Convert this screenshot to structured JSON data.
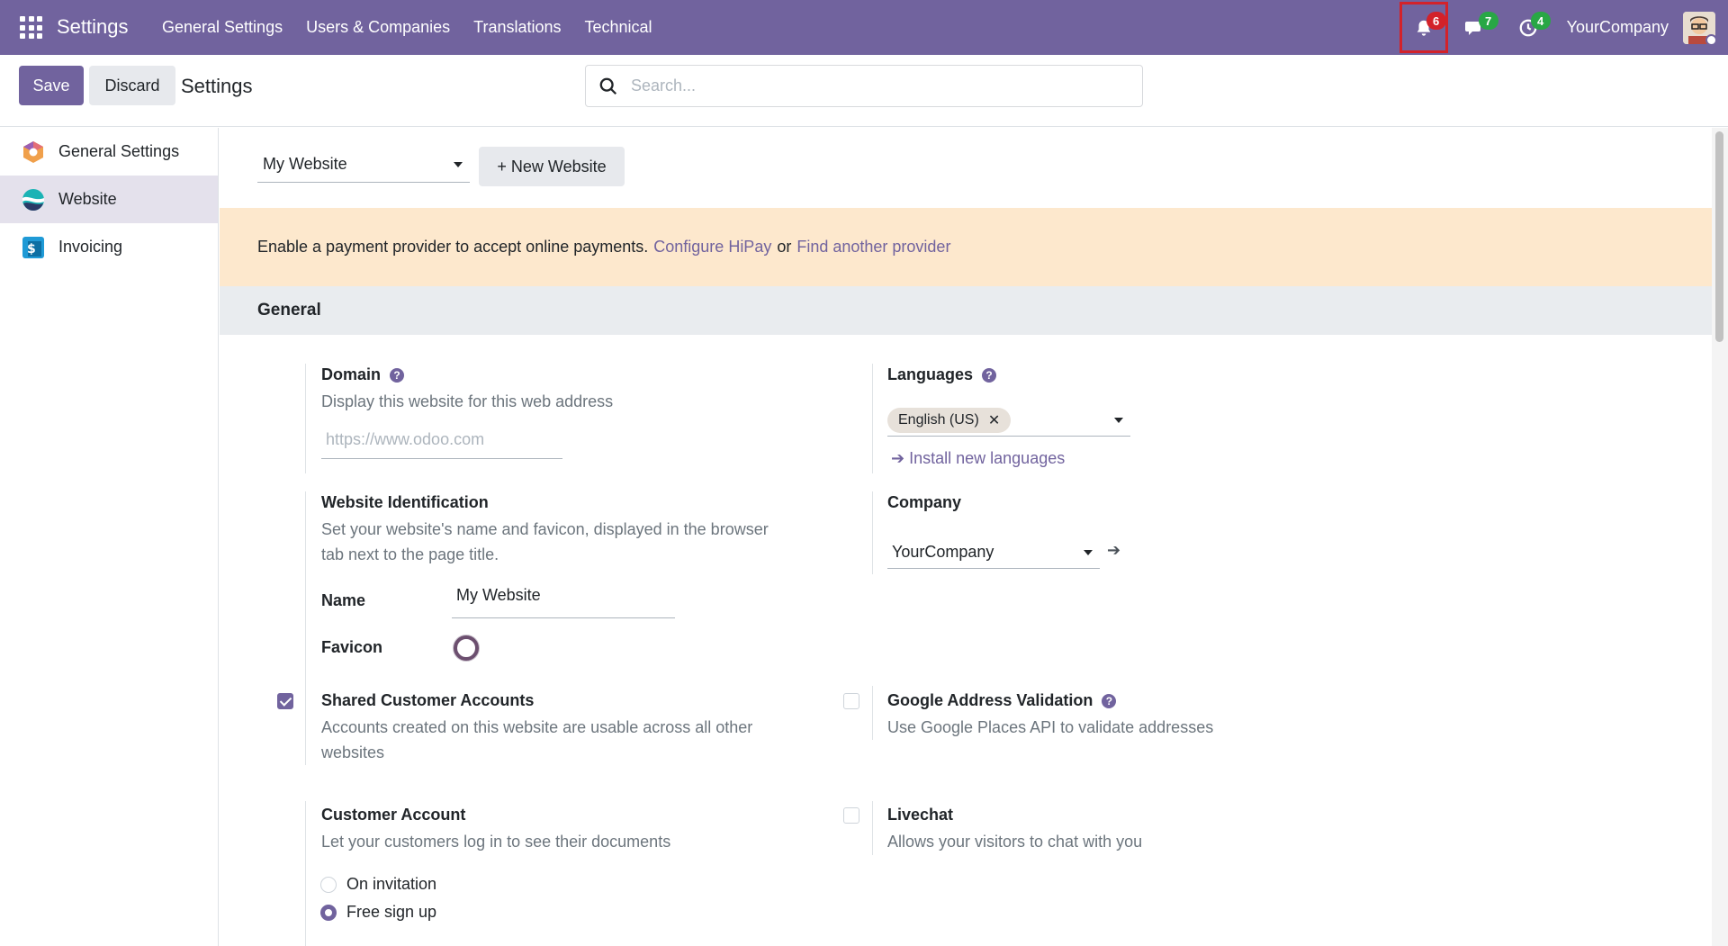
{
  "navbar": {
    "brand": "Settings",
    "menu": [
      "General Settings",
      "Users & Companies",
      "Translations",
      "Technical"
    ],
    "activity_count": "6",
    "messages_count": "7",
    "clock_count": "4",
    "company": "YourCompany"
  },
  "control": {
    "save_label": "Save",
    "discard_label": "Discard",
    "title": "Settings",
    "search_placeholder": "Search..."
  },
  "sidebar": {
    "items": [
      {
        "label": "General Settings",
        "icon": "odoo-logo-icon"
      },
      {
        "label": "Website",
        "icon": "website-app-icon"
      },
      {
        "label": "Invoicing",
        "icon": "invoicing-app-icon"
      }
    ],
    "active": "Website"
  },
  "website_bar": {
    "selected_website": "My Website",
    "new_website_label": "+ New Website"
  },
  "alert": {
    "text": "Enable a payment provider to accept online payments.",
    "link1": "Configure HiPay",
    "or": "or",
    "link2": "Find another provider"
  },
  "section": {
    "title": "General"
  },
  "settings": {
    "domain": {
      "title": "Domain",
      "desc": "Display this website for this web address",
      "placeholder": "https://www.odoo.com"
    },
    "languages": {
      "title": "Languages",
      "tag": "English (US)",
      "link": "Install new languages"
    },
    "identification": {
      "title": "Website Identification",
      "desc_line1": "Set your website's name and favicon, displayed in the browser",
      "desc_line2": "tab next to the page title.",
      "name_label": "Name",
      "name_value": "My Website",
      "favicon_label": "Favicon"
    },
    "company": {
      "title": "Company",
      "value": "YourCompany"
    },
    "shared_accounts": {
      "title": "Shared Customer Accounts",
      "desc_line1": "Accounts created on this website are usable across all other",
      "desc_line2": "websites",
      "checked": true
    },
    "google_address": {
      "title": "Google Address Validation",
      "desc": "Use Google Places API to validate addresses",
      "checked": false
    },
    "customer_account": {
      "title": "Customer Account",
      "desc": "Let your customers log in to see their documents",
      "options": [
        "On invitation",
        "Free sign up"
      ],
      "selected": "Free sign up"
    },
    "livechat": {
      "title": "Livechat",
      "desc": "Allows your visitors to chat with you",
      "checked": false
    }
  },
  "colors": {
    "brand": "#71639e",
    "alert_bg": "#fde8cd",
    "badge_red": "#d3222a",
    "badge_green": "#28a745"
  }
}
